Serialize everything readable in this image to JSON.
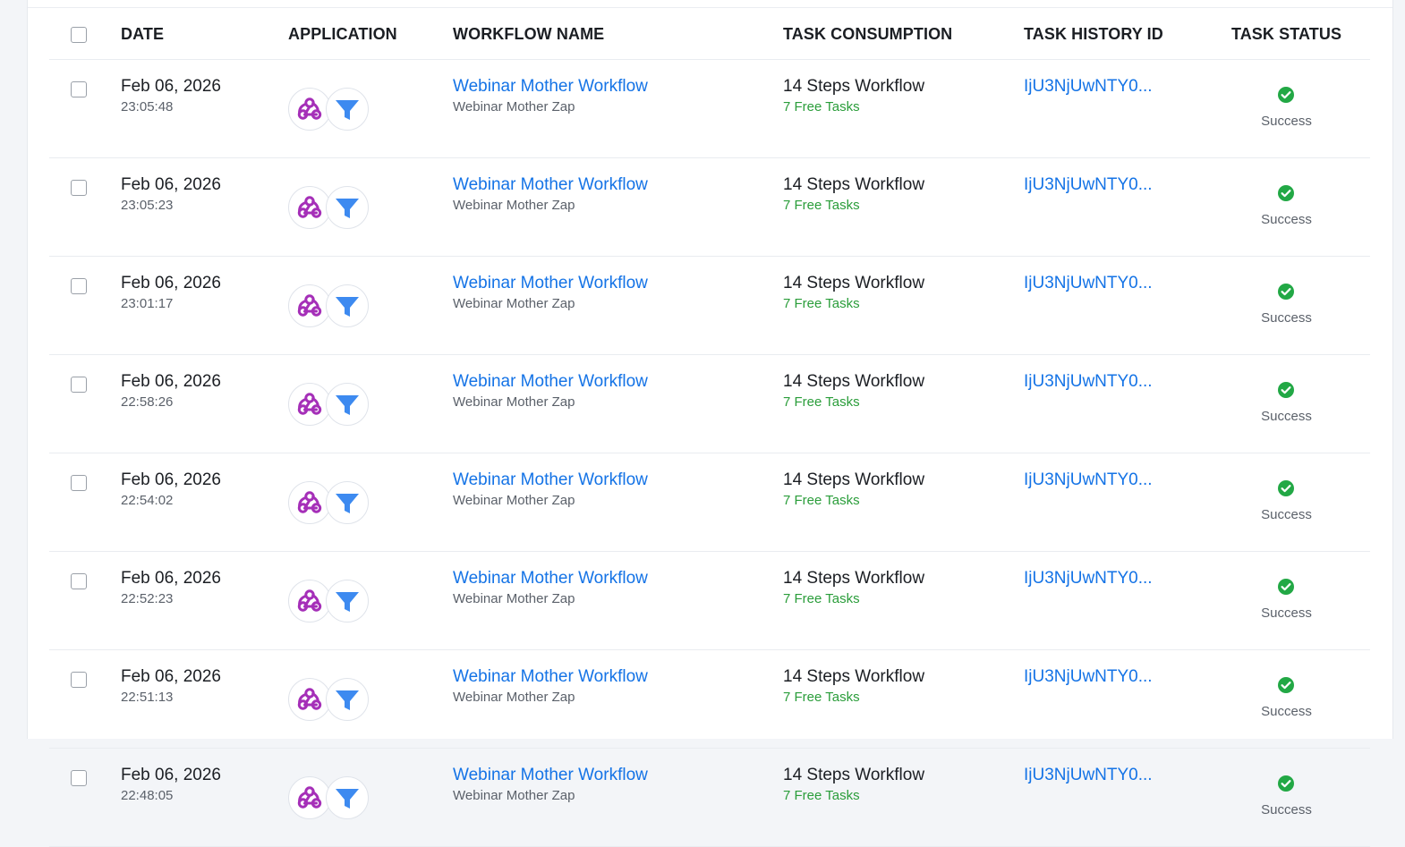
{
  "table": {
    "headers": {
      "date": "DATE",
      "application": "APPLICATION",
      "workflow_name": "WORKFLOW NAME",
      "task_consumption": "TASK CONSUMPTION",
      "task_history_id": "TASK HISTORY ID",
      "task_status": "TASK STATUS"
    },
    "rows": [
      {
        "date": "Feb 06, 2026",
        "time": "23:05:48",
        "workflow": "Webinar Mother Workflow",
        "workflow_sub": "Webinar Mother Zap",
        "steps": "14 Steps Workflow",
        "free_tasks": "7 Free Tasks",
        "history_id": "IjU3NjUwNTY0...",
        "status": "Success"
      },
      {
        "date": "Feb 06, 2026",
        "time": "23:05:23",
        "workflow": "Webinar Mother Workflow",
        "workflow_sub": "Webinar Mother Zap",
        "steps": "14 Steps Workflow",
        "free_tasks": "7 Free Tasks",
        "history_id": "IjU3NjUwNTY0...",
        "status": "Success"
      },
      {
        "date": "Feb 06, 2026",
        "time": "23:01:17",
        "workflow": "Webinar Mother Workflow",
        "workflow_sub": "Webinar Mother Zap",
        "steps": "14 Steps Workflow",
        "free_tasks": "7 Free Tasks",
        "history_id": "IjU3NjUwNTY0...",
        "status": "Success"
      },
      {
        "date": "Feb 06, 2026",
        "time": "22:58:26",
        "workflow": "Webinar Mother Workflow",
        "workflow_sub": "Webinar Mother Zap",
        "steps": "14 Steps Workflow",
        "free_tasks": "7 Free Tasks",
        "history_id": "IjU3NjUwNTY0...",
        "status": "Success"
      },
      {
        "date": "Feb 06, 2026",
        "time": "22:54:02",
        "workflow": "Webinar Mother Workflow",
        "workflow_sub": "Webinar Mother Zap",
        "steps": "14 Steps Workflow",
        "free_tasks": "7 Free Tasks",
        "history_id": "IjU3NjUwNTY0...",
        "status": "Success"
      },
      {
        "date": "Feb 06, 2026",
        "time": "22:52:23",
        "workflow": "Webinar Mother Workflow",
        "workflow_sub": "Webinar Mother Zap",
        "steps": "14 Steps Workflow",
        "free_tasks": "7 Free Tasks",
        "history_id": "IjU3NjUwNTY0...",
        "status": "Success"
      },
      {
        "date": "Feb 06, 2026",
        "time": "22:51:13",
        "workflow": "Webinar Mother Workflow",
        "workflow_sub": "Webinar Mother Zap",
        "steps": "14 Steps Workflow",
        "free_tasks": "7 Free Tasks",
        "history_id": "IjU3NjUwNTY0...",
        "status": "Success"
      },
      {
        "date": "Feb 06, 2026",
        "time": "22:48:05",
        "workflow": "Webinar Mother Workflow",
        "workflow_sub": "Webinar Mother Zap",
        "steps": "14 Steps Workflow",
        "free_tasks": "7 Free Tasks",
        "history_id": "IjU3NjUwNTY0...",
        "status": "Success"
      }
    ]
  },
  "icons": {
    "app_1": "webhook-icon",
    "app_2": "filter-icon",
    "status": "check-circle-icon"
  },
  "colors": {
    "link": "#1473e6",
    "free_tasks": "#2a9d3a",
    "success": "#22a845",
    "webhook": "#a52fb8",
    "filter": "#3d8af0"
  }
}
